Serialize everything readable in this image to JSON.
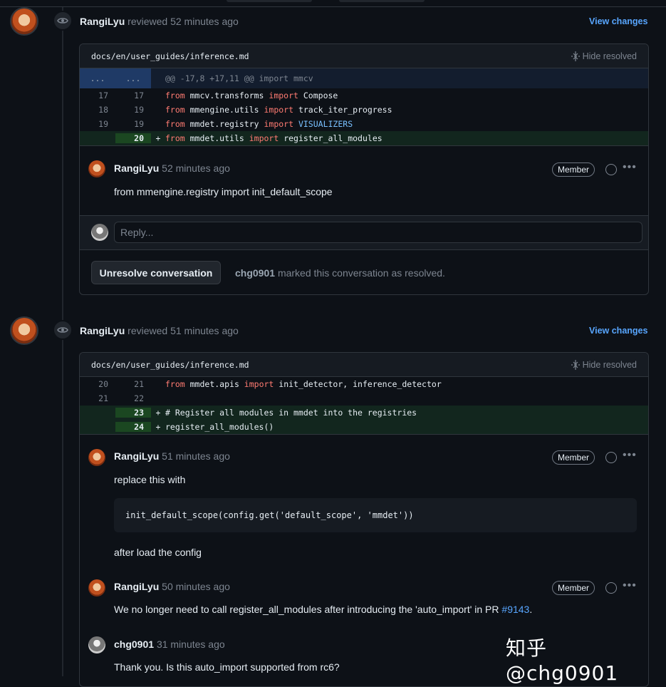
{
  "reviews": [
    {
      "reviewer": "RangiLyu",
      "action": "reviewed",
      "time": "52 minutes ago",
      "view_changes": "View changes",
      "file_path": "docs/en/user_guides/inference.md",
      "hide_resolved": "Hide resolved",
      "hunk": {
        "left": "...",
        "right": "...",
        "text": "@@ -17,8 +17,11 @@ import mmcv"
      },
      "lines": [
        {
          "old": "17",
          "new": "17",
          "marker": "",
          "t1": "from",
          "t2": " mmcv.transforms ",
          "t3": "import",
          "t4": " Compose"
        },
        {
          "old": "18",
          "new": "19",
          "marker": "",
          "t1": "from",
          "t2": " mmengine.utils ",
          "t3": "import",
          "t4": " track_iter_progress"
        },
        {
          "old": "19",
          "new": "19",
          "marker": "",
          "t1": "from",
          "t2": " mmdet.registry ",
          "t3": "import",
          "t4": " VISUALIZERS"
        },
        {
          "old": "",
          "new": "20",
          "marker": "+",
          "t1": "from",
          "t2": " mmdet.utils ",
          "t3": "import",
          "t4": " register_all_modules"
        }
      ],
      "comment": {
        "author": "RangiLyu",
        "time": "52 minutes ago",
        "badge": "Member",
        "text": "from mmengine.registry import init_default_scope"
      },
      "reply_placeholder": "Reply...",
      "unresolve_label": "Unresolve conversation",
      "resolved_by": "chg0901",
      "resolved_text": "marked this conversation as resolved."
    },
    {
      "reviewer": "RangiLyu",
      "action": "reviewed",
      "time": "51 minutes ago",
      "view_changes": "View changes",
      "file_path": "docs/en/user_guides/inference.md",
      "hide_resolved": "Hide resolved",
      "lines": [
        {
          "old": "20",
          "new": "21",
          "marker": "",
          "t1": "from",
          "t2": " mmdet.apis ",
          "t3": "import",
          "t4": " init_detector, inference_detector"
        },
        {
          "old": "21",
          "new": "22",
          "marker": "",
          "text": ""
        },
        {
          "old": "",
          "new": "23",
          "marker": "+",
          "comment": "# Register all modules in mmdet into the registries"
        },
        {
          "old": "",
          "new": "24",
          "marker": "+",
          "text": "register_all_modules()"
        }
      ],
      "comments": [
        {
          "author": "RangiLyu",
          "time": "51 minutes ago",
          "badge": "Member",
          "text1": "replace this with",
          "code": "init_default_scope(config.get('default_scope', 'mmdet'))",
          "text2": "after load the config"
        },
        {
          "author": "RangiLyu",
          "time": "50 minutes ago",
          "badge": "Member",
          "text": "We no longer need to call register_all_modules after introducing the 'auto_import' in PR ",
          "link": "#9143",
          "text_end": "."
        },
        {
          "author": "chg0901",
          "time": "31 minutes ago",
          "text": "Thank you. Is this auto_import supported from rc6?"
        }
      ]
    }
  ],
  "watermark": "知乎 @chg0901",
  "colors": {
    "accent": "#58a6ff",
    "added_bg": "#12261e",
    "hunk_bg": "#131d2e",
    "keyword": "#ff7b72",
    "constant": "#79c0ff"
  }
}
